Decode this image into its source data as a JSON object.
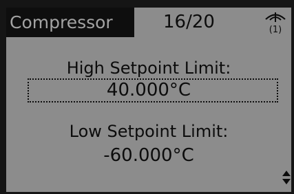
{
  "header": {
    "menu_title": "Compressor",
    "page_indicator": "16/20",
    "language_icon": "globe-language-icon",
    "language_code": "(1)"
  },
  "high_setpoint": {
    "label": "High Setpoint Limit:",
    "value": "40.000°C",
    "selected": true
  },
  "low_setpoint": {
    "label": "Low Setpoint Limit:",
    "value": "-60.000°C"
  },
  "scroll_indicator": "up-down-arrows-icon",
  "colors": {
    "lcd_background": "#8c8c8c",
    "text": "#0c0c0c",
    "title_bar": "#0e0e0e",
    "title_text": "#a3a3a3"
  }
}
